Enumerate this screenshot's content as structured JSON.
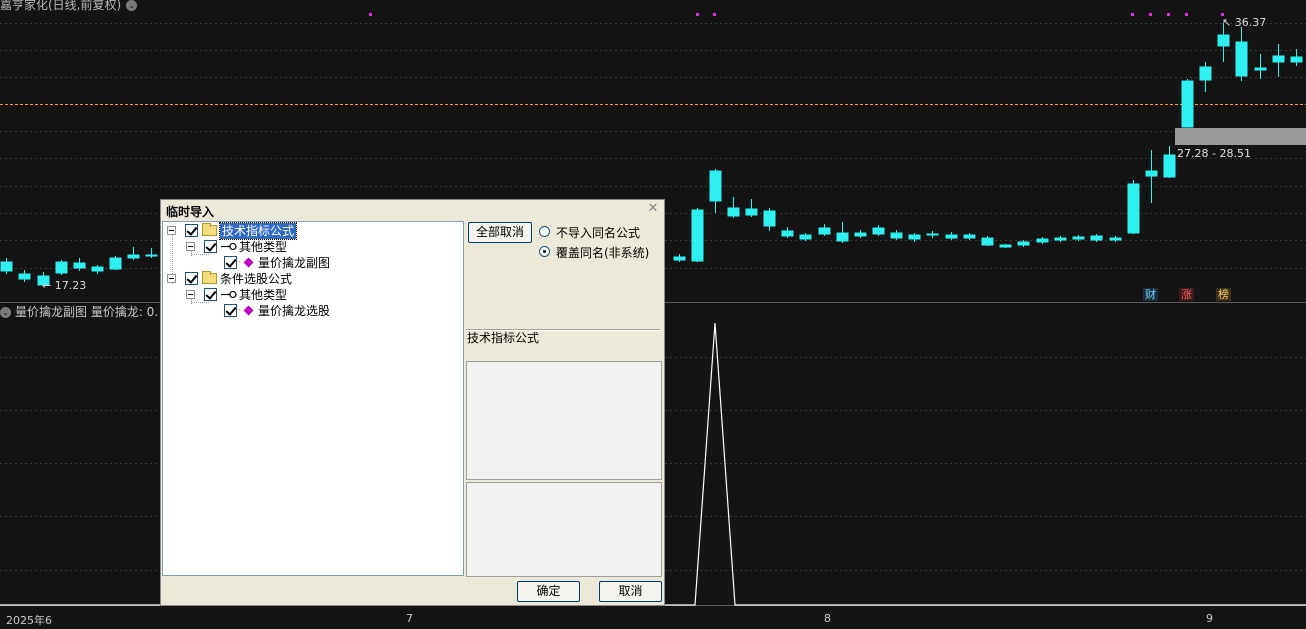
{
  "window": {
    "title": "嘉亨家化(日线,前复权)"
  },
  "main_chart": {
    "high_label": "36.37",
    "low_label": "17.23",
    "range_label": "27.28 - 28.51"
  },
  "badges": {
    "cai": "财",
    "zhang": "涨",
    "bang": "榜"
  },
  "sub_chart": {
    "title": "量价擒龙副图  量价擒龙: 0."
  },
  "time_axis": [
    "2025年6",
    "7",
    "8",
    "9"
  ],
  "colors": {
    "up": "#ff3d3d",
    "down": "#2ef0f0",
    "background": "#141414",
    "dialog": "#ece9d8",
    "selection": "#316ac5"
  },
  "dialog": {
    "title": "临时导入",
    "tree": [
      {
        "label": "技术指标公式",
        "level": 0,
        "icon": "folder-icon",
        "selected": true
      },
      {
        "label": "其他类型",
        "level": 1,
        "icon": "key-icon"
      },
      {
        "label": "量价擒龙副图",
        "level": 2,
        "icon": "diamond-icon"
      },
      {
        "label": "条件选股公式",
        "level": 0,
        "icon": "folder-icon"
      },
      {
        "label": "其他类型",
        "level": 1,
        "icon": "key-icon"
      },
      {
        "label": "量价擒龙选股",
        "level": 2,
        "icon": "diamond-icon"
      }
    ],
    "cancel_all_label": "全部取消",
    "radio_no_import": "不导入同名公式",
    "radio_overwrite": "覆盖同名(非系统)",
    "radio_selected": "overwrite",
    "type_label": "技术指标公式",
    "ok_label": "确定",
    "cancel_label": "取消"
  }
}
